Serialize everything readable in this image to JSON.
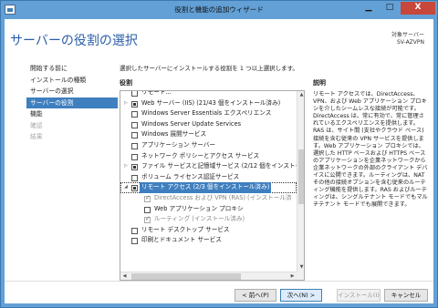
{
  "window": {
    "title": "役割と機能の追加ウィザード",
    "min_glyph": "▁",
    "max_glyph": "□",
    "close_glyph": "X"
  },
  "header": {
    "page_title": "サーバーの役割の選択",
    "server_label": "対象サーバー",
    "server_name": "SV-AZVPN"
  },
  "nav": {
    "items": [
      {
        "label": "開始する前に",
        "state": "normal"
      },
      {
        "label": "インストールの種類",
        "state": "normal"
      },
      {
        "label": "サーバーの選択",
        "state": "normal"
      },
      {
        "label": "サーバーの役割",
        "state": "active"
      },
      {
        "label": "機能",
        "state": "normal"
      },
      {
        "label": "確認",
        "state": "disabled"
      },
      {
        "label": "結果",
        "state": "disabled"
      }
    ]
  },
  "main": {
    "instruction": "選択したサーバーにインストールする役割を 1 つ以上選択します。",
    "roles_heading": "役割",
    "description_heading": "説明",
    "description": "リモート アクセスでは、DirectAccess、VPN、および Web アプリケーション プロキシを介したシームレスな接続が可能です。DirectAccess は、常に有効で、常に管理されているエクスペリエンスを提供します。RAS は、サイト間 (支社やクラウド ベース) 接続を含む従来の VPN サービスを提供します。Web アプリケーション プロキシでは、選択した HTTP ベースおよび HTTPS ベースのアプリケーションを企業ネットワークから企業ネットワークの外部のクライアント デバイスに公開できます。ルーティングは、NAT その他の接続オプションを含む従来のルーティング機能を提供します。RAS およびルーティングは、シングルテナント モードでもマルチテナント モードでも展開できます。"
  },
  "roles": [
    {
      "label": "リモート...",
      "indent": 0,
      "expander": "",
      "check": "none",
      "style": "normal"
    },
    {
      "label": "Web サーバー (IIS) (21/43 個をインストール済み)",
      "indent": 0,
      "expander": "▷",
      "check": "partial",
      "style": "normal"
    },
    {
      "label": "Windows Server Essentials エクスペリエンス",
      "indent": 0,
      "expander": "",
      "check": "none",
      "style": "normal"
    },
    {
      "label": "Windows Server Update Services",
      "indent": 0,
      "expander": "",
      "check": "none",
      "style": "normal"
    },
    {
      "label": "Windows 展開サービス",
      "indent": 0,
      "expander": "",
      "check": "none",
      "style": "normal"
    },
    {
      "label": "アプリケーション サーバー",
      "indent": 0,
      "expander": "",
      "check": "none",
      "style": "normal"
    },
    {
      "label": "ネットワーク ポリシーとアクセス サービス",
      "indent": 0,
      "expander": "",
      "check": "none",
      "style": "normal"
    },
    {
      "label": "ファイル サービスと記憶域サービス (2/12 個をインストー",
      "indent": 0,
      "expander": "▷",
      "check": "partial",
      "style": "normal"
    },
    {
      "label": "ボリューム ライセンス認証サービス",
      "indent": 0,
      "expander": "",
      "check": "none",
      "style": "normal"
    },
    {
      "label": "リモート アクセス (2/3 個をインストール済み)",
      "indent": 0,
      "expander": "◢",
      "check": "partial",
      "style": "selected"
    },
    {
      "label": "DirectAccess および VPN (RAS) (インストール済",
      "indent": 1,
      "expander": "",
      "check": "checked",
      "style": "grey"
    },
    {
      "label": "Web アプリケーション プロキシ",
      "indent": 1,
      "expander": "",
      "check": "none",
      "style": "normal"
    },
    {
      "label": "ルーティング (インストール済み)",
      "indent": 1,
      "expander": "",
      "check": "checked",
      "style": "grey"
    },
    {
      "label": "リモート デスクトップ サービス",
      "indent": 0,
      "expander": "",
      "check": "none",
      "style": "normal"
    },
    {
      "label": "印刷とドキュメント サービス",
      "indent": 0,
      "expander": "",
      "check": "none",
      "style": "normal"
    }
  ],
  "scroll": {
    "up": "▲",
    "down": "▼",
    "left": "◀",
    "right": "▶",
    "grip": "⦀"
  },
  "buttons": {
    "back": "< 前へ(P)",
    "next": "次へ(N) >",
    "install": "インストール(I)",
    "cancel": "キャンセル"
  }
}
